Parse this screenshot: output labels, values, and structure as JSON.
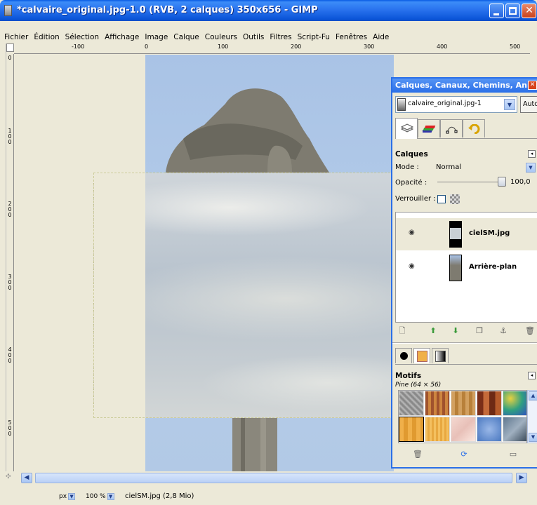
{
  "window": {
    "title": "*calvaire_original.jpg-1.0 (RVB, 2 calques) 350x656 - GIMP",
    "close_glyph": "✕"
  },
  "menu": [
    "Fichier",
    "Édition",
    "Sélection",
    "Affichage",
    "Image",
    "Calque",
    "Couleurs",
    "Outils",
    "Filtres",
    "Script-Fu",
    "Fenêtres",
    "Aide"
  ],
  "ruler": {
    "h_labels": [
      "-100",
      "0",
      "100",
      "200",
      "300",
      "400",
      "500"
    ],
    "v_labels": [
      "0",
      "100",
      "200",
      "300",
      "400",
      "500"
    ]
  },
  "status": {
    "unit": "px",
    "zoom": "100 %",
    "text": "cielSM.jpg (2,8 Mio)"
  },
  "dock": {
    "title": "Calques, Canaux, Chemins, Ann...",
    "image_select": "calvaire_original.jpg-1",
    "auto_label": "Auto",
    "layers": {
      "heading": "Calques",
      "mode_label": "Mode :",
      "mode_value": "Normal",
      "opacity_label": "Opacité :",
      "opacity_value": "100,0",
      "lock_label": "Verrouiller :",
      "items": [
        {
          "name": "cielSM.jpg",
          "selected": true
        },
        {
          "name": "Arrière-plan",
          "selected": false
        }
      ]
    },
    "patterns": {
      "heading": "Motifs",
      "current": "Pine (64 × 56)"
    }
  },
  "colors": {
    "accent": "#2a6fe8",
    "titlebar": "#0b55d8",
    "sky": "#b2c9e6",
    "stone": "#7d7a6f"
  },
  "icons": {
    "eye": "eye-icon",
    "new_layer": "new-layer-icon",
    "raise": "raise-layer-icon",
    "lower": "lower-layer-icon",
    "duplicate": "duplicate-layer-icon",
    "anchor": "anchor-layer-icon",
    "delete": "trash-icon",
    "refresh": "refresh-icon",
    "folder": "folder-icon"
  }
}
